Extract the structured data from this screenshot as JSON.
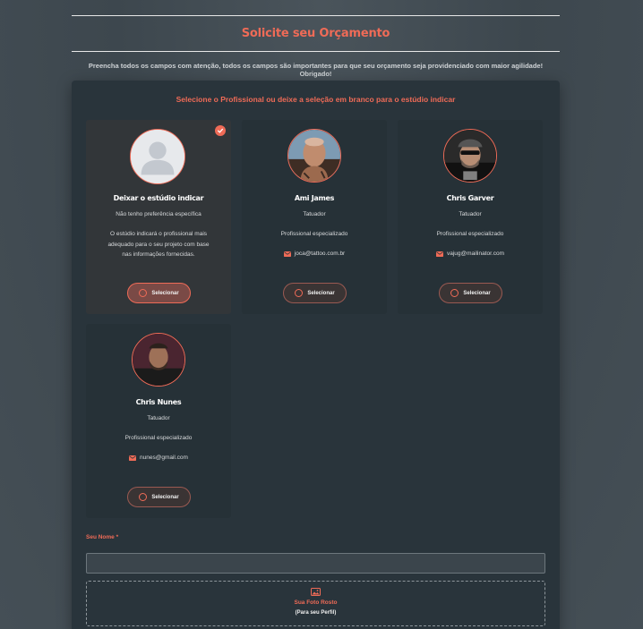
{
  "header": {
    "title": "Solicite seu Orçamento"
  },
  "subtitle": "Preencha todos os campos com atenção, todos os campos são importantes para que seu orçamento seja providenciado com maior agilidade! Obrigado!",
  "panel": {
    "title": "Selecione o Profissional ou deixe a seleção em branco para o estúdio indicar",
    "select_label": "Selecionar",
    "cards": [
      {
        "name": "Deixar o estúdio indicar",
        "role": "Não tenho preferência específica",
        "description": "O estúdio indicará o profissional mais adequado para o seu projeto com base nas informações fornecidas.",
        "selected": true,
        "avatar": "default-user-icon"
      },
      {
        "name": "Ami James",
        "role": "Tatuador",
        "specialty": "Profissional especializado",
        "email": "joca@tattoo.com.br",
        "selected": false,
        "avatar": "photo"
      },
      {
        "name": "Chris Garver",
        "role": "Tatuador",
        "specialty": "Profissional especializado",
        "email": "vajug@mailinator.com",
        "selected": false,
        "avatar": "photo"
      },
      {
        "name": "Chris Nunes",
        "role": "Tatuador",
        "specialty": "Profissional especializado",
        "email": "nunes@gmail.com",
        "selected": false,
        "avatar": "photo"
      }
    ]
  },
  "form": {
    "name_label": "Seu Nome *",
    "name_value": "",
    "photo_title": "Sua Foto Rosto",
    "photo_subtitle": "(Para seu Perfil)"
  },
  "colors": {
    "accent": "#ef6b57",
    "panel": "#29343b",
    "card": "#263137"
  }
}
